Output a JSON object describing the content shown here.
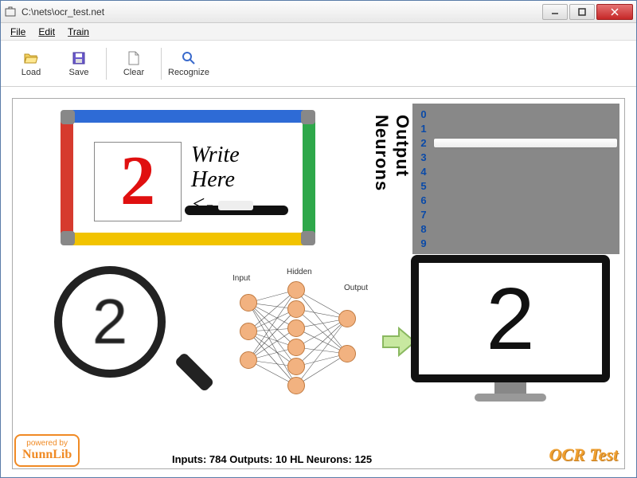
{
  "window": {
    "title": "C:\\nets\\ocr_test.net"
  },
  "menu": {
    "file": "File",
    "edit": "Edit",
    "train": "Train"
  },
  "toolbar": {
    "load": "Load",
    "save": "Save",
    "clear": "Clear",
    "recognize": "Recognize"
  },
  "whiteboard": {
    "drawn": "2",
    "hint1": "Write",
    "hint2": "Here",
    "hint3": "<-"
  },
  "output_neurons": {
    "label": "Output Neurons",
    "rows": [
      {
        "id": "0",
        "activation": 0.0
      },
      {
        "id": "1",
        "activation": 0.0
      },
      {
        "id": "2",
        "activation": 1.0
      },
      {
        "id": "3",
        "activation": 0.0
      },
      {
        "id": "4",
        "activation": 0.0
      },
      {
        "id": "5",
        "activation": 0.0
      },
      {
        "id": "6",
        "activation": 0.0
      },
      {
        "id": "7",
        "activation": 0.0
      },
      {
        "id": "8",
        "activation": 0.0
      },
      {
        "id": "9",
        "activation": 0.0
      }
    ]
  },
  "magnifier": {
    "sample": "2"
  },
  "nn": {
    "input_label": "Input",
    "hidden_label": "Hidden",
    "output_label": "Output"
  },
  "monitor": {
    "result": "2"
  },
  "powered": {
    "line1": "powered by",
    "line2": "NunnLib"
  },
  "stats": {
    "text": "Inputs: 784   Outputs: 10   HL Neurons: 125"
  },
  "brand": {
    "text": "OCR Test"
  }
}
